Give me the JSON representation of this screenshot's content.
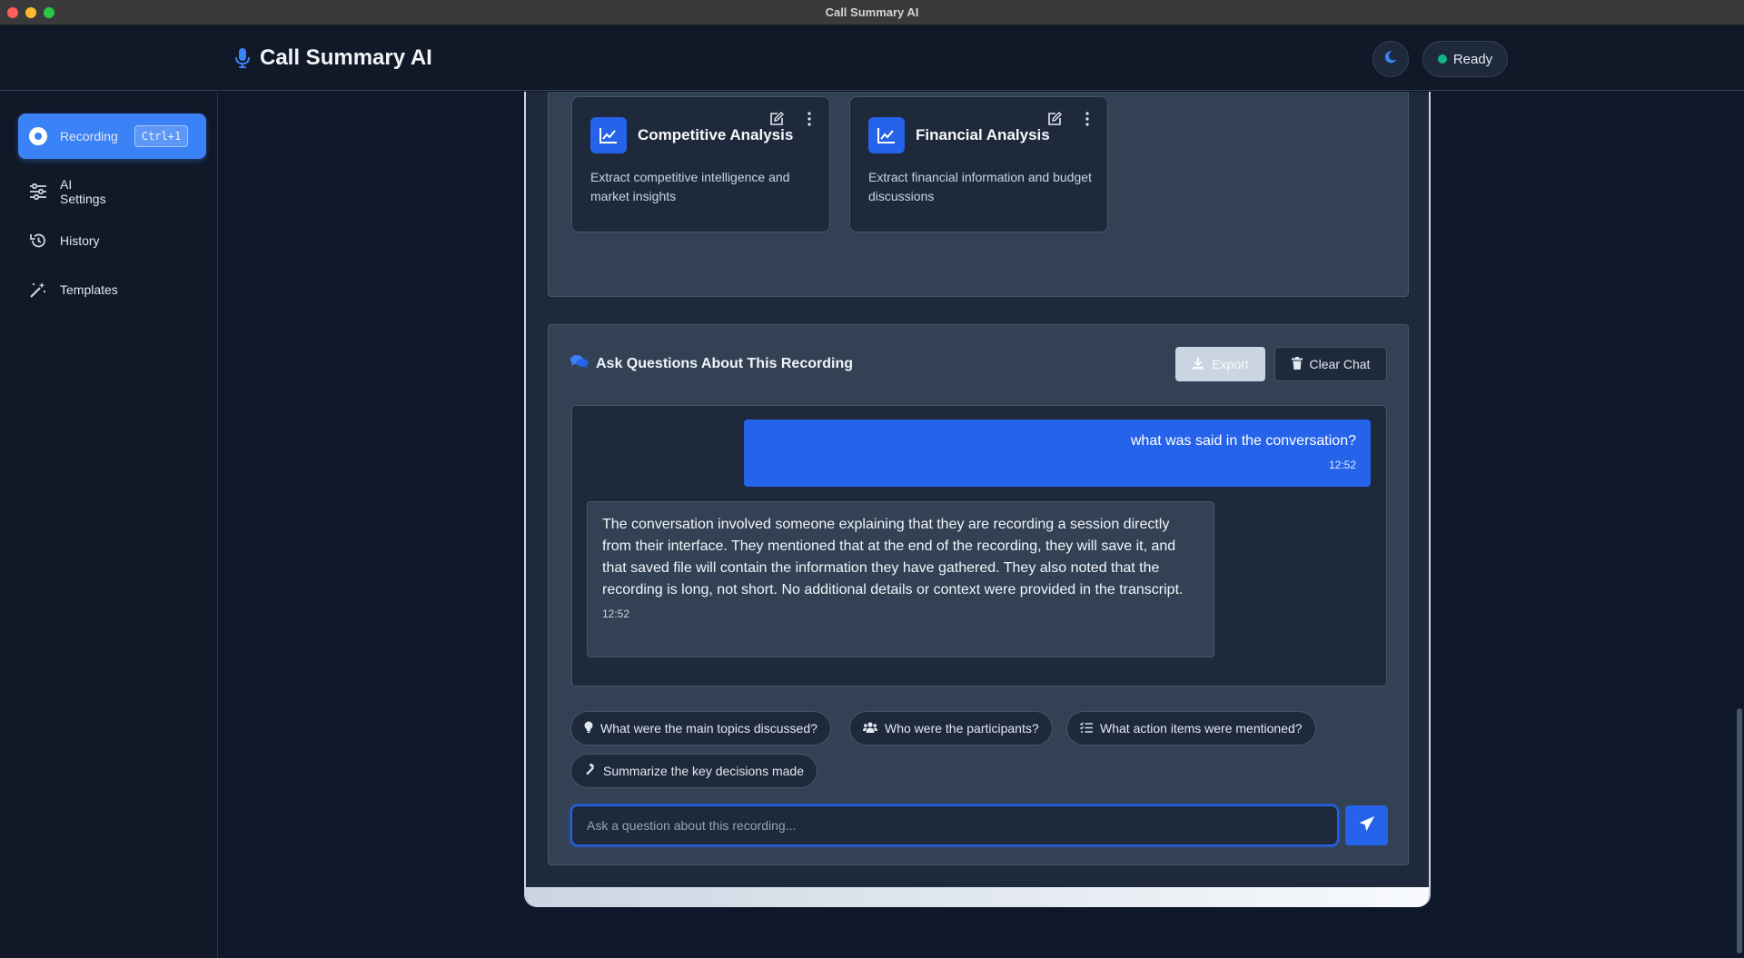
{
  "window": {
    "title": "Call Summary AI"
  },
  "header": {
    "app_name": "Call Summary AI",
    "status": "Ready"
  },
  "sidebar": {
    "items": [
      {
        "label": "Recording",
        "shortcut": "Ctrl+1",
        "icon": "record-icon"
      },
      {
        "label": "AI\nSettings",
        "icon": "sliders-icon"
      },
      {
        "label": "History",
        "icon": "history-icon"
      },
      {
        "label": "Templates",
        "icon": "magic-wand-icon"
      }
    ]
  },
  "templates": [
    {
      "title": "Competitive Analysis",
      "description": "Extract competitive intelligence and market insights",
      "icon": "chart-line-icon"
    },
    {
      "title": "Financial Analysis",
      "description": "Extract financial information and budget discussions",
      "icon": "chart-line-icon"
    }
  ],
  "chat": {
    "title": "Ask Questions About This Recording",
    "export_label": "Export",
    "clear_label": "Clear Chat",
    "messages": [
      {
        "role": "user",
        "text": "what was said in the conversation?",
        "time": "12:52"
      },
      {
        "role": "assistant",
        "text": "The conversation involved someone explaining that they are recording a session directly from their interface. They mentioned that at the end of the recording, they will save it, and that saved file will contain the information they have gathered. They also noted that the recording is long, not short. No additional details or context were provided in the transcript.",
        "time": "12:52"
      }
    ],
    "suggestions": [
      {
        "label": "What were the main topics discussed?",
        "icon": "lightbulb-icon"
      },
      {
        "label": "Who were the participants?",
        "icon": "users-icon"
      },
      {
        "label": "What action items were mentioned?",
        "icon": "list-check-icon"
      },
      {
        "label": "Summarize the key decisions made",
        "icon": "gavel-icon"
      }
    ],
    "input_placeholder": "Ask a question about this recording..."
  },
  "colors": {
    "accent": "#2563eb",
    "status_ready": "#10b981",
    "background": "#0f172a"
  }
}
